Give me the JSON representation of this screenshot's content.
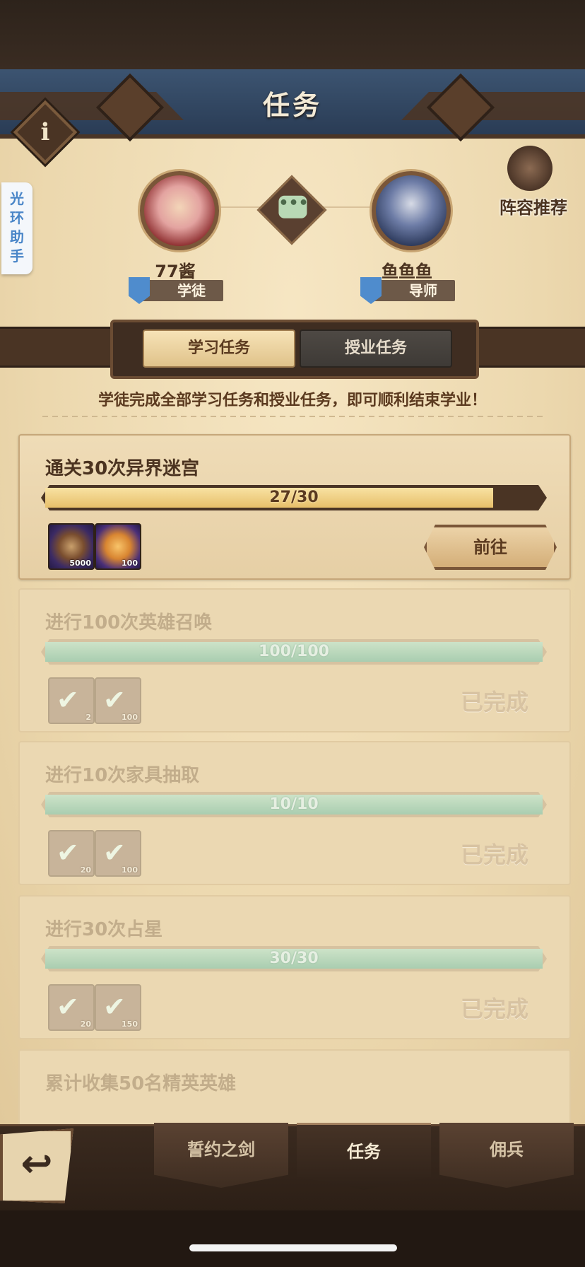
{
  "header": {
    "title": "任务",
    "info_glyph": "i"
  },
  "side": {
    "assistant_label": "光环助手",
    "lineup_label": "阵容推荐"
  },
  "pair": {
    "student": {
      "name": "77酱",
      "role": "学徒"
    },
    "mentor": {
      "name": "鱼鱼鱼",
      "role": "导师"
    }
  },
  "tabs": [
    {
      "label": "学习任务",
      "active": true
    },
    {
      "label": "授业任务",
      "active": false
    }
  ],
  "notice": "学徒完成全部学习任务和授业任务，即可顺利结束学业！",
  "tasks": [
    {
      "title": "通关30次异界迷宫",
      "progress_text": "27/30",
      "progress": 0.9,
      "rewards": [
        {
          "icon": "token-icon",
          "count": "5000"
        },
        {
          "icon": "crystal-icon",
          "count": "100"
        }
      ],
      "action": "前往",
      "completed": false
    },
    {
      "title": "进行100次英雄召唤",
      "progress_text": "100/100",
      "progress": 1.0,
      "rewards": [
        {
          "icon": "check-icon",
          "count": "2"
        },
        {
          "icon": "check-icon",
          "count": "100"
        }
      ],
      "status": "已完成",
      "completed": true
    },
    {
      "title": "进行10次家具抽取",
      "progress_text": "10/10",
      "progress": 1.0,
      "rewards": [
        {
          "icon": "check-icon",
          "count": "20"
        },
        {
          "icon": "check-icon",
          "count": "100"
        }
      ],
      "status": "已完成",
      "completed": true
    },
    {
      "title": "进行30次占星",
      "progress_text": "30/30",
      "progress": 1.0,
      "rewards": [
        {
          "icon": "check-icon",
          "count": "20"
        },
        {
          "icon": "check-icon",
          "count": "150"
        }
      ],
      "status": "已完成",
      "completed": true
    },
    {
      "title": "累计收集50名精英英雄",
      "completed": true
    }
  ],
  "bottom_nav": [
    {
      "label": "誓约之剑"
    },
    {
      "label": "任务",
      "active": true
    },
    {
      "label": "佣兵"
    }
  ],
  "colors": {
    "parchment": "#ecd8ae",
    "progress_gold": "#e7bf6a",
    "progress_green": "#a9cdb0",
    "role_blue": "#4f8ccd"
  }
}
